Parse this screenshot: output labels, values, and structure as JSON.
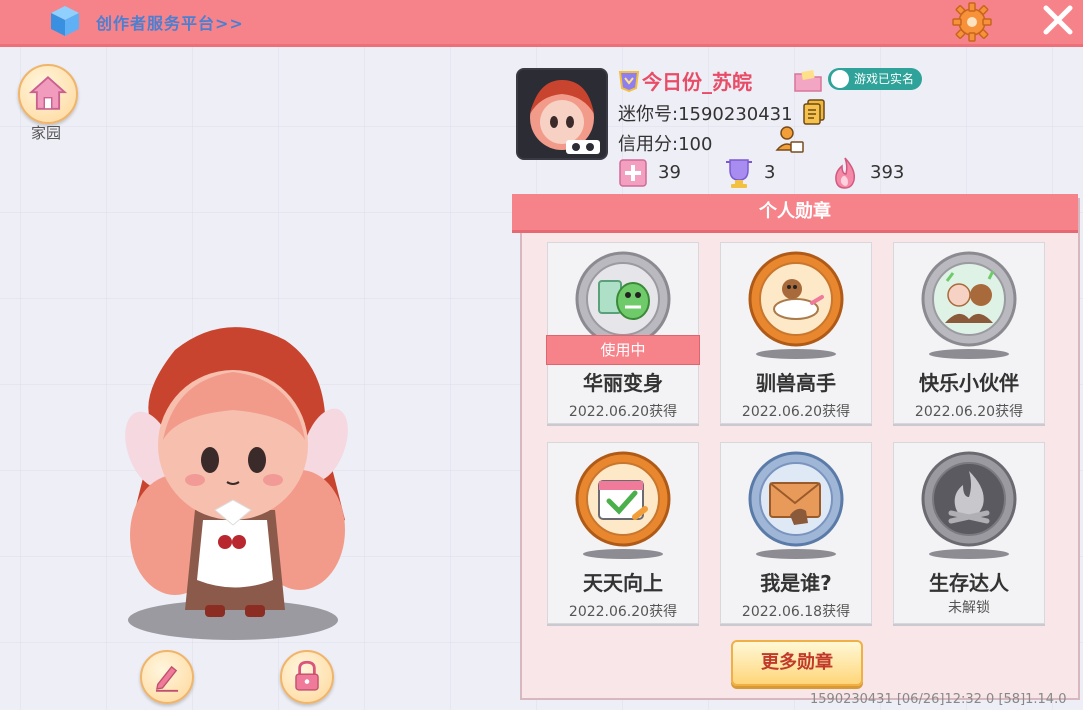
{
  "topbar": {
    "platform_link": "创作者服务平台>>"
  },
  "left": {
    "home_label": "家园"
  },
  "profile": {
    "name": "今日份_苏皖",
    "verified": "游戏已实名",
    "mini_id": "迷你号:1590230431",
    "credit": "信用分:100",
    "stats": [
      "39",
      "3",
      "393"
    ]
  },
  "medals": {
    "title": "个人勋章",
    "in_use_label": "使用中",
    "items": [
      {
        "name": "华丽变身",
        "date": "2022.06.20获得"
      },
      {
        "name": "驯兽高手",
        "date": "2022.06.20获得"
      },
      {
        "name": "快乐小伙伴",
        "date": "2022.06.20获得"
      },
      {
        "name": "天天向上",
        "date": "2022.06.20获得"
      },
      {
        "name": "我是谁?",
        "date": "2022.06.18获得"
      },
      {
        "name": "生存达人",
        "date": "未解锁"
      }
    ],
    "more_button": "更多勋章"
  },
  "footer": {
    "info": "1590230431   [06/26]12:32 0  [58]1.14.0"
  },
  "colors": {
    "header": "#f7838a",
    "name": "#e94c67",
    "link": "#4b7fd1",
    "bronze": "#e8872e",
    "silver": "#9a9aa0"
  }
}
